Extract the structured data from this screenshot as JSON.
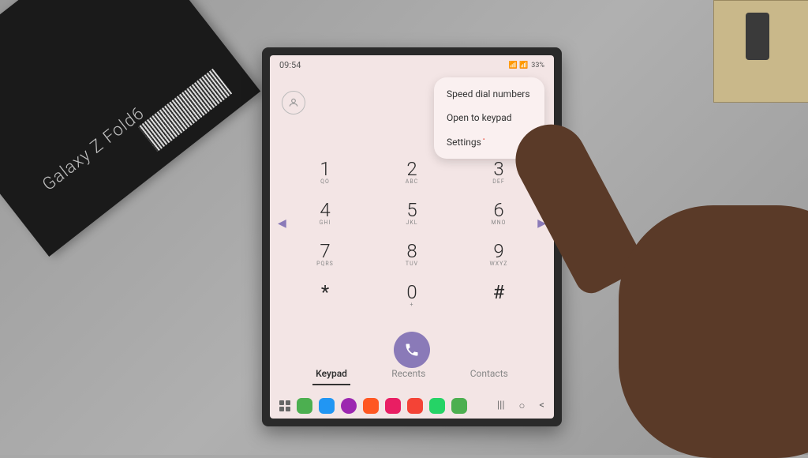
{
  "product_box": {
    "label": "Galaxy Z Fold6"
  },
  "status": {
    "time": "09:54",
    "battery": "33%",
    "signal_icons": "📶 📶"
  },
  "menu": {
    "items": [
      {
        "label": "Speed dial numbers"
      },
      {
        "label": "Open to keypad"
      },
      {
        "label": "Settings"
      }
    ]
  },
  "keypad": {
    "keys": [
      [
        {
          "n": "1",
          "l": "QO"
        },
        {
          "n": "2",
          "l": "ABC"
        },
        {
          "n": "3",
          "l": "DEF"
        }
      ],
      [
        {
          "n": "4",
          "l": "GHI"
        },
        {
          "n": "5",
          "l": "JKL"
        },
        {
          "n": "6",
          "l": "MNO"
        }
      ],
      [
        {
          "n": "7",
          "l": "PQRS"
        },
        {
          "n": "8",
          "l": "TUV"
        },
        {
          "n": "9",
          "l": "WXYZ"
        }
      ],
      [
        {
          "n": "*",
          "l": ""
        },
        {
          "n": "0",
          "l": "+"
        },
        {
          "n": "#",
          "l": ""
        }
      ]
    ],
    "arrows": {
      "left": "◀",
      "right": "▶"
    }
  },
  "tabs": {
    "keypad": "Keypad",
    "recents": "Recents",
    "contacts": "Contacts"
  },
  "nav": {
    "recent": "|||",
    "home": "○",
    "back": "<"
  }
}
